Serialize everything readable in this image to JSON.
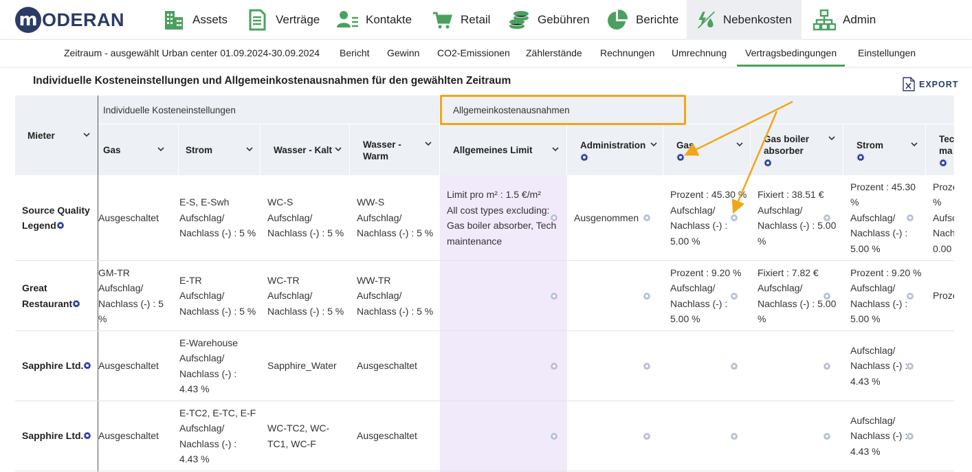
{
  "brand": {
    "logo_letter": "m",
    "logo_text": "ODERAN"
  },
  "nav": {
    "items": [
      {
        "label": "Assets",
        "icon": "buildings-icon"
      },
      {
        "label": "Verträge",
        "icon": "document-icon"
      },
      {
        "label": "Kontakte",
        "icon": "contacts-icon"
      },
      {
        "label": "Retail",
        "icon": "cart-icon"
      },
      {
        "label": "Gebühren",
        "icon": "coins-icon"
      },
      {
        "label": "Berichte",
        "icon": "pie-chart-icon"
      },
      {
        "label": "Nebenkosten",
        "icon": "utilities-icon",
        "active": true
      },
      {
        "label": "Admin",
        "icon": "org-chart-icon"
      }
    ]
  },
  "subnav": {
    "period": "Zeitraum - ausgewählt Urban center 01.09.2024-30.09.2024",
    "items": [
      "Bericht",
      "Gewinn",
      "CO2-Emissionen",
      "Zählerstände",
      "Rechnungen",
      "Umrechnung",
      "Vertragsbedingungen",
      "Einstellungen"
    ],
    "active": "Vertragsbedingungen"
  },
  "page": {
    "title": "Individuelle Kosteneinstellungen und Allgemeinkostenausnahmen für den gewählten Zeitraum",
    "export_label": "EXPORT"
  },
  "table": {
    "group_headers": {
      "individual": "Individuelle Kosteneinstellungen",
      "exceptions": "Allgemeinkostenausnahmen"
    },
    "tenant_header": "Mieter",
    "columns": {
      "gas": "Gas",
      "strom": "Strom",
      "wasser_kalt": "Wasser - Kalt",
      "wasser_warm": [
        "Wasser -",
        "Warm"
      ],
      "limit": "Allgemeines Limit",
      "admin": "Administration",
      "ex_gas": "Gas",
      "gas_boiler": [
        "Gas boiler",
        "absorber"
      ],
      "ex_strom": "Strom",
      "tech": [
        "Tec",
        "ma"
      ]
    },
    "rows": [
      {
        "tenant": [
          "Source Quality",
          "Legend"
        ],
        "gas": [
          "Ausgeschaltet"
        ],
        "strom": [
          "E-S, E-Swh",
          "Aufschlag/",
          "Nachlass (-) : 5 %"
        ],
        "wasser_kalt": [
          "WC-S",
          "Aufschlag/",
          "Nachlass (-) : 5 %"
        ],
        "wasser_warm": [
          "WW-S",
          "Aufschlag/",
          "Nachlass (-) : 5 %"
        ],
        "limit": [
          "Limit pro m² : 1.5 €/m²",
          "All cost types excluding:",
          "Gas boiler absorber, Tech",
          "maintenance"
        ],
        "admin": [
          "Ausgenommen"
        ],
        "ex_gas": [
          "Prozent : 45.30 %",
          "Aufschlag/",
          "Nachlass (-) :",
          "5.00 %"
        ],
        "gas_boiler": [
          "Fixiert : 38.51 €",
          "Aufschlag/",
          "Nachlass (-) : 5.00",
          "%"
        ],
        "ex_strom": [
          "Prozent : 45.30",
          "%",
          "Aufschlag/",
          "Nachlass (-) :",
          "5.00 %"
        ],
        "tech": [
          "Proze",
          "%",
          "Aufsc",
          "Nach",
          "0.00"
        ]
      },
      {
        "tenant": [
          "Great",
          "Restaurant"
        ],
        "gas": [
          "GM-TR",
          "Aufschlag/",
          "Nachlass (-) : 5",
          "%"
        ],
        "strom": [
          "E-TR",
          "Aufschlag/",
          "Nachlass (-) : 5 %"
        ],
        "wasser_kalt": [
          "WC-TR",
          "Aufschlag/",
          "Nachlass (-) : 5 %"
        ],
        "wasser_warm": [
          "WW-TR",
          "Aufschlag/",
          "Nachlass (-) : 5 %"
        ],
        "limit": [],
        "admin": [],
        "ex_gas": [
          "Prozent : 9.20 %",
          "Aufschlag/",
          "Nachlass (-) :",
          "5.00 %"
        ],
        "gas_boiler": [
          "Fixiert : 7.82 €",
          "Aufschlag/",
          "Nachlass (-) : 5.00",
          "%"
        ],
        "ex_strom": [
          "Prozent : 9.20 %",
          "Aufschlag/",
          "Nachlass (-) :",
          "5.00 %"
        ],
        "tech": [
          "Proze"
        ]
      },
      {
        "tenant": [
          "Sapphire Ltd."
        ],
        "gas": [
          "Ausgeschaltet"
        ],
        "strom": [
          "E-Warehouse",
          "Aufschlag/",
          "Nachlass (-) :",
          "4.43 %"
        ],
        "wasser_kalt": [
          "Sapphire_Water"
        ],
        "wasser_warm": [
          "Ausgeschaltet"
        ],
        "limit": [],
        "admin": [],
        "ex_gas": [],
        "gas_boiler": [],
        "ex_strom": [
          "Aufschlag/",
          "Nachlass (-) :",
          "4.43 %"
        ],
        "tech": []
      },
      {
        "tenant": [
          "Sapphire Ltd."
        ],
        "gas": [
          "Ausgeschaltet"
        ],
        "strom": [
          "E-TC2, E-TC, E-F",
          "Aufschlag/",
          "Nachlass (-) :",
          "4.43 %"
        ],
        "wasser_kalt": [
          "WC-TC2, WC-",
          "TC1, WC-F"
        ],
        "wasser_warm": [
          "Ausgeschaltet"
        ],
        "limit": [],
        "admin": [],
        "ex_gas": [],
        "gas_boiler": [],
        "ex_strom": [
          "Aufschlag/",
          "Nachlass (-) :",
          "4.43 %"
        ],
        "tech": []
      }
    ]
  },
  "colors": {
    "brand": "#2a3b66",
    "nav_green": "#4aa15e",
    "header_bg": "#edf0f4",
    "limit_bg": "#f1eafb",
    "highlight": "#f0a616",
    "gear_blue": "#2e3fa6",
    "gear_light": "#b6bfd6"
  }
}
